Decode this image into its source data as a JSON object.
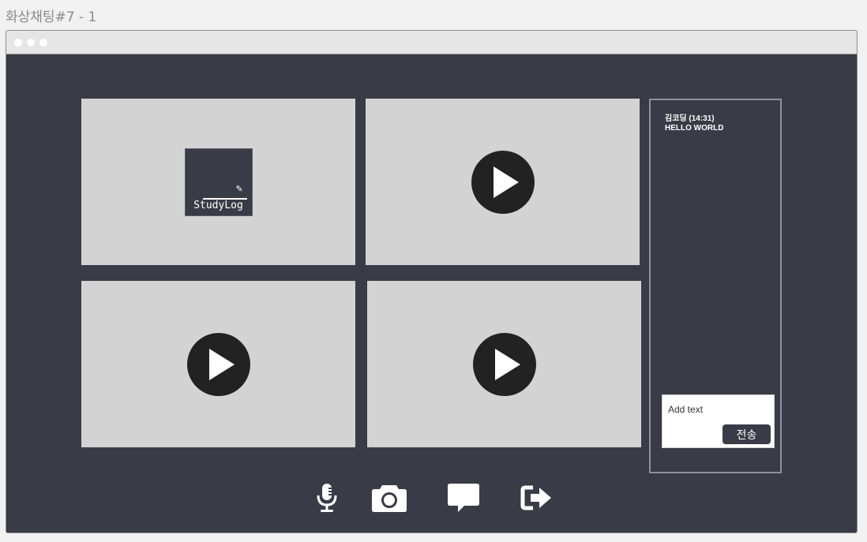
{
  "page": {
    "title": "화상채팅#7 - 1"
  },
  "chat": {
    "message_header": "김코딩 (14:31)",
    "message_text": "HELLO WORLD",
    "input_placeholder": "Add text",
    "send_label": "전송"
  },
  "logo": {
    "text": "StudyLog"
  },
  "icons": {
    "mic": "microphone-icon",
    "camera": "camera-icon",
    "chat": "chat-bubble-icon",
    "exit": "exit-icon"
  },
  "colors": {
    "app_background": "#393c46",
    "tile_background": "#d3d3d3",
    "play_button": "#222222",
    "accent_text": "#ffffff"
  }
}
